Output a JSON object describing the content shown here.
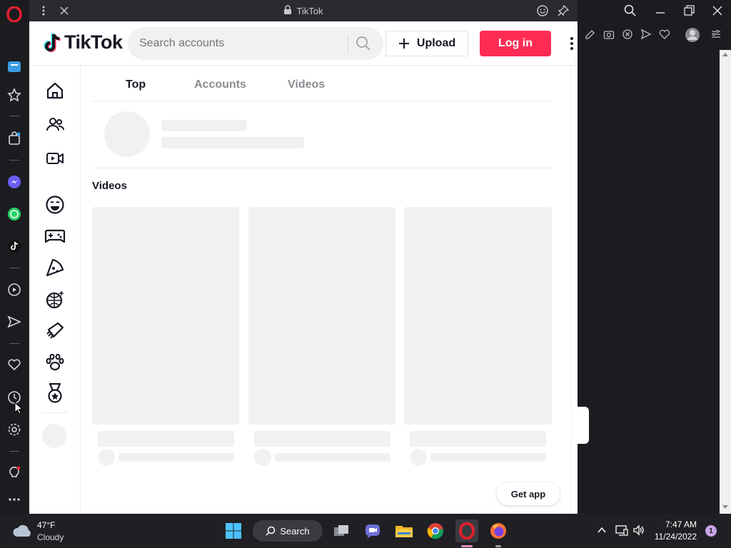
{
  "popup": {
    "title": "TikTok"
  },
  "tiktok": {
    "logo_text": "TikTok",
    "search": {
      "placeholder": "Search accounts"
    },
    "upload_label": "Upload",
    "login_label": "Log in",
    "tabs": [
      {
        "label": "Top",
        "active": true
      },
      {
        "label": "Accounts",
        "active": false
      },
      {
        "label": "Videos",
        "active": false
      }
    ],
    "section_title": "Videos",
    "get_app_label": "Get app",
    "nav_icons": [
      "home-icon",
      "following-icon",
      "live-icon",
      "comedy-emoji-icon",
      "gaming-controller-icon",
      "food-pizza-icon",
      "dance-disco-ball-icon",
      "beauty-comb-icon",
      "animals-paw-icon",
      "sports-medal-icon"
    ],
    "colors": {
      "brand_red": "#fe2c55",
      "text": "#161823",
      "skeleton": "#f1f1f2"
    }
  },
  "opera_sidebar_icons": [
    "opera-logo-icon",
    "workspace-icon",
    "speed-dial-icon",
    "shopping-icon",
    "messenger-icon",
    "whatsapp-icon",
    "tiktok-icon",
    "player-icon",
    "send-icon",
    "bookmarks-heart-icon",
    "history-clock-icon",
    "settings-gear-icon",
    "tips-bulb-icon",
    "more-icon"
  ],
  "taskbar": {
    "weather": {
      "temp": "47°F",
      "desc": "Cloudy"
    },
    "search_label": "Search",
    "time": "7:47 AM",
    "date": "11/24/2022",
    "notification_count": "1"
  }
}
